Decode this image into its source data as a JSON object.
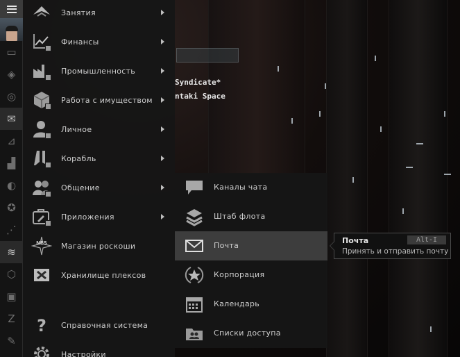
{
  "background": {
    "text_line_1": "Syndicate*",
    "text_line_2": "ntaki Space"
  },
  "neocom": {
    "items": [
      {
        "icon": "chat-icon"
      },
      {
        "icon": "cube-icon"
      },
      {
        "icon": "magnifier-icon"
      },
      {
        "icon": "mail-icon"
      },
      {
        "icon": "chart-icon"
      },
      {
        "icon": "factory-icon"
      },
      {
        "icon": "industry-icon"
      },
      {
        "icon": "star-icon"
      },
      {
        "icon": "network-icon"
      },
      {
        "icon": "layers-icon"
      },
      {
        "icon": "tower-icon"
      },
      {
        "icon": "box-icon"
      },
      {
        "icon": "z-icon"
      },
      {
        "icon": "edit-icon"
      }
    ]
  },
  "menu": {
    "items": [
      {
        "label": "Занятия",
        "icon": "activities-icon",
        "has_submenu": true
      },
      {
        "label": "Финансы",
        "icon": "finance-icon",
        "has_submenu": true
      },
      {
        "label": "Промышленность",
        "icon": "industry-icon",
        "has_submenu": true
      },
      {
        "label": "Работа с имуществом",
        "icon": "assets-icon",
        "has_submenu": true
      },
      {
        "label": "Личное",
        "icon": "personal-icon",
        "has_submenu": true
      },
      {
        "label": "Корабль",
        "icon": "ship-icon",
        "has_submenu": true
      },
      {
        "label": "Общение",
        "icon": "social-icon",
        "has_submenu": true
      },
      {
        "label": "Приложения",
        "icon": "apps-icon",
        "has_submenu": true
      },
      {
        "label": "Магазин роскоши",
        "icon": "nes-icon",
        "has_submenu": false
      },
      {
        "label": "Хранилище плексов",
        "icon": "plex-vault-icon",
        "has_submenu": false
      },
      {
        "label": "Справочная система",
        "icon": "help-icon",
        "has_submenu": false
      },
      {
        "label": "Настройки",
        "icon": "settings-icon",
        "has_submenu": false
      }
    ]
  },
  "submenu": {
    "items": [
      {
        "label": "Каналы чата",
        "icon": "chat-channels-icon"
      },
      {
        "label": "Штаб флота",
        "icon": "fleet-icon"
      },
      {
        "label": "Почта",
        "icon": "mail-icon"
      },
      {
        "label": "Корпорация",
        "icon": "corporation-icon"
      },
      {
        "label": "Календарь",
        "icon": "calendar-icon"
      },
      {
        "label": "Списки доступа",
        "icon": "access-lists-icon"
      }
    ]
  },
  "tooltip": {
    "title": "Почта",
    "shortcut": "Alt-I",
    "description": "Принять и отправить почту"
  }
}
